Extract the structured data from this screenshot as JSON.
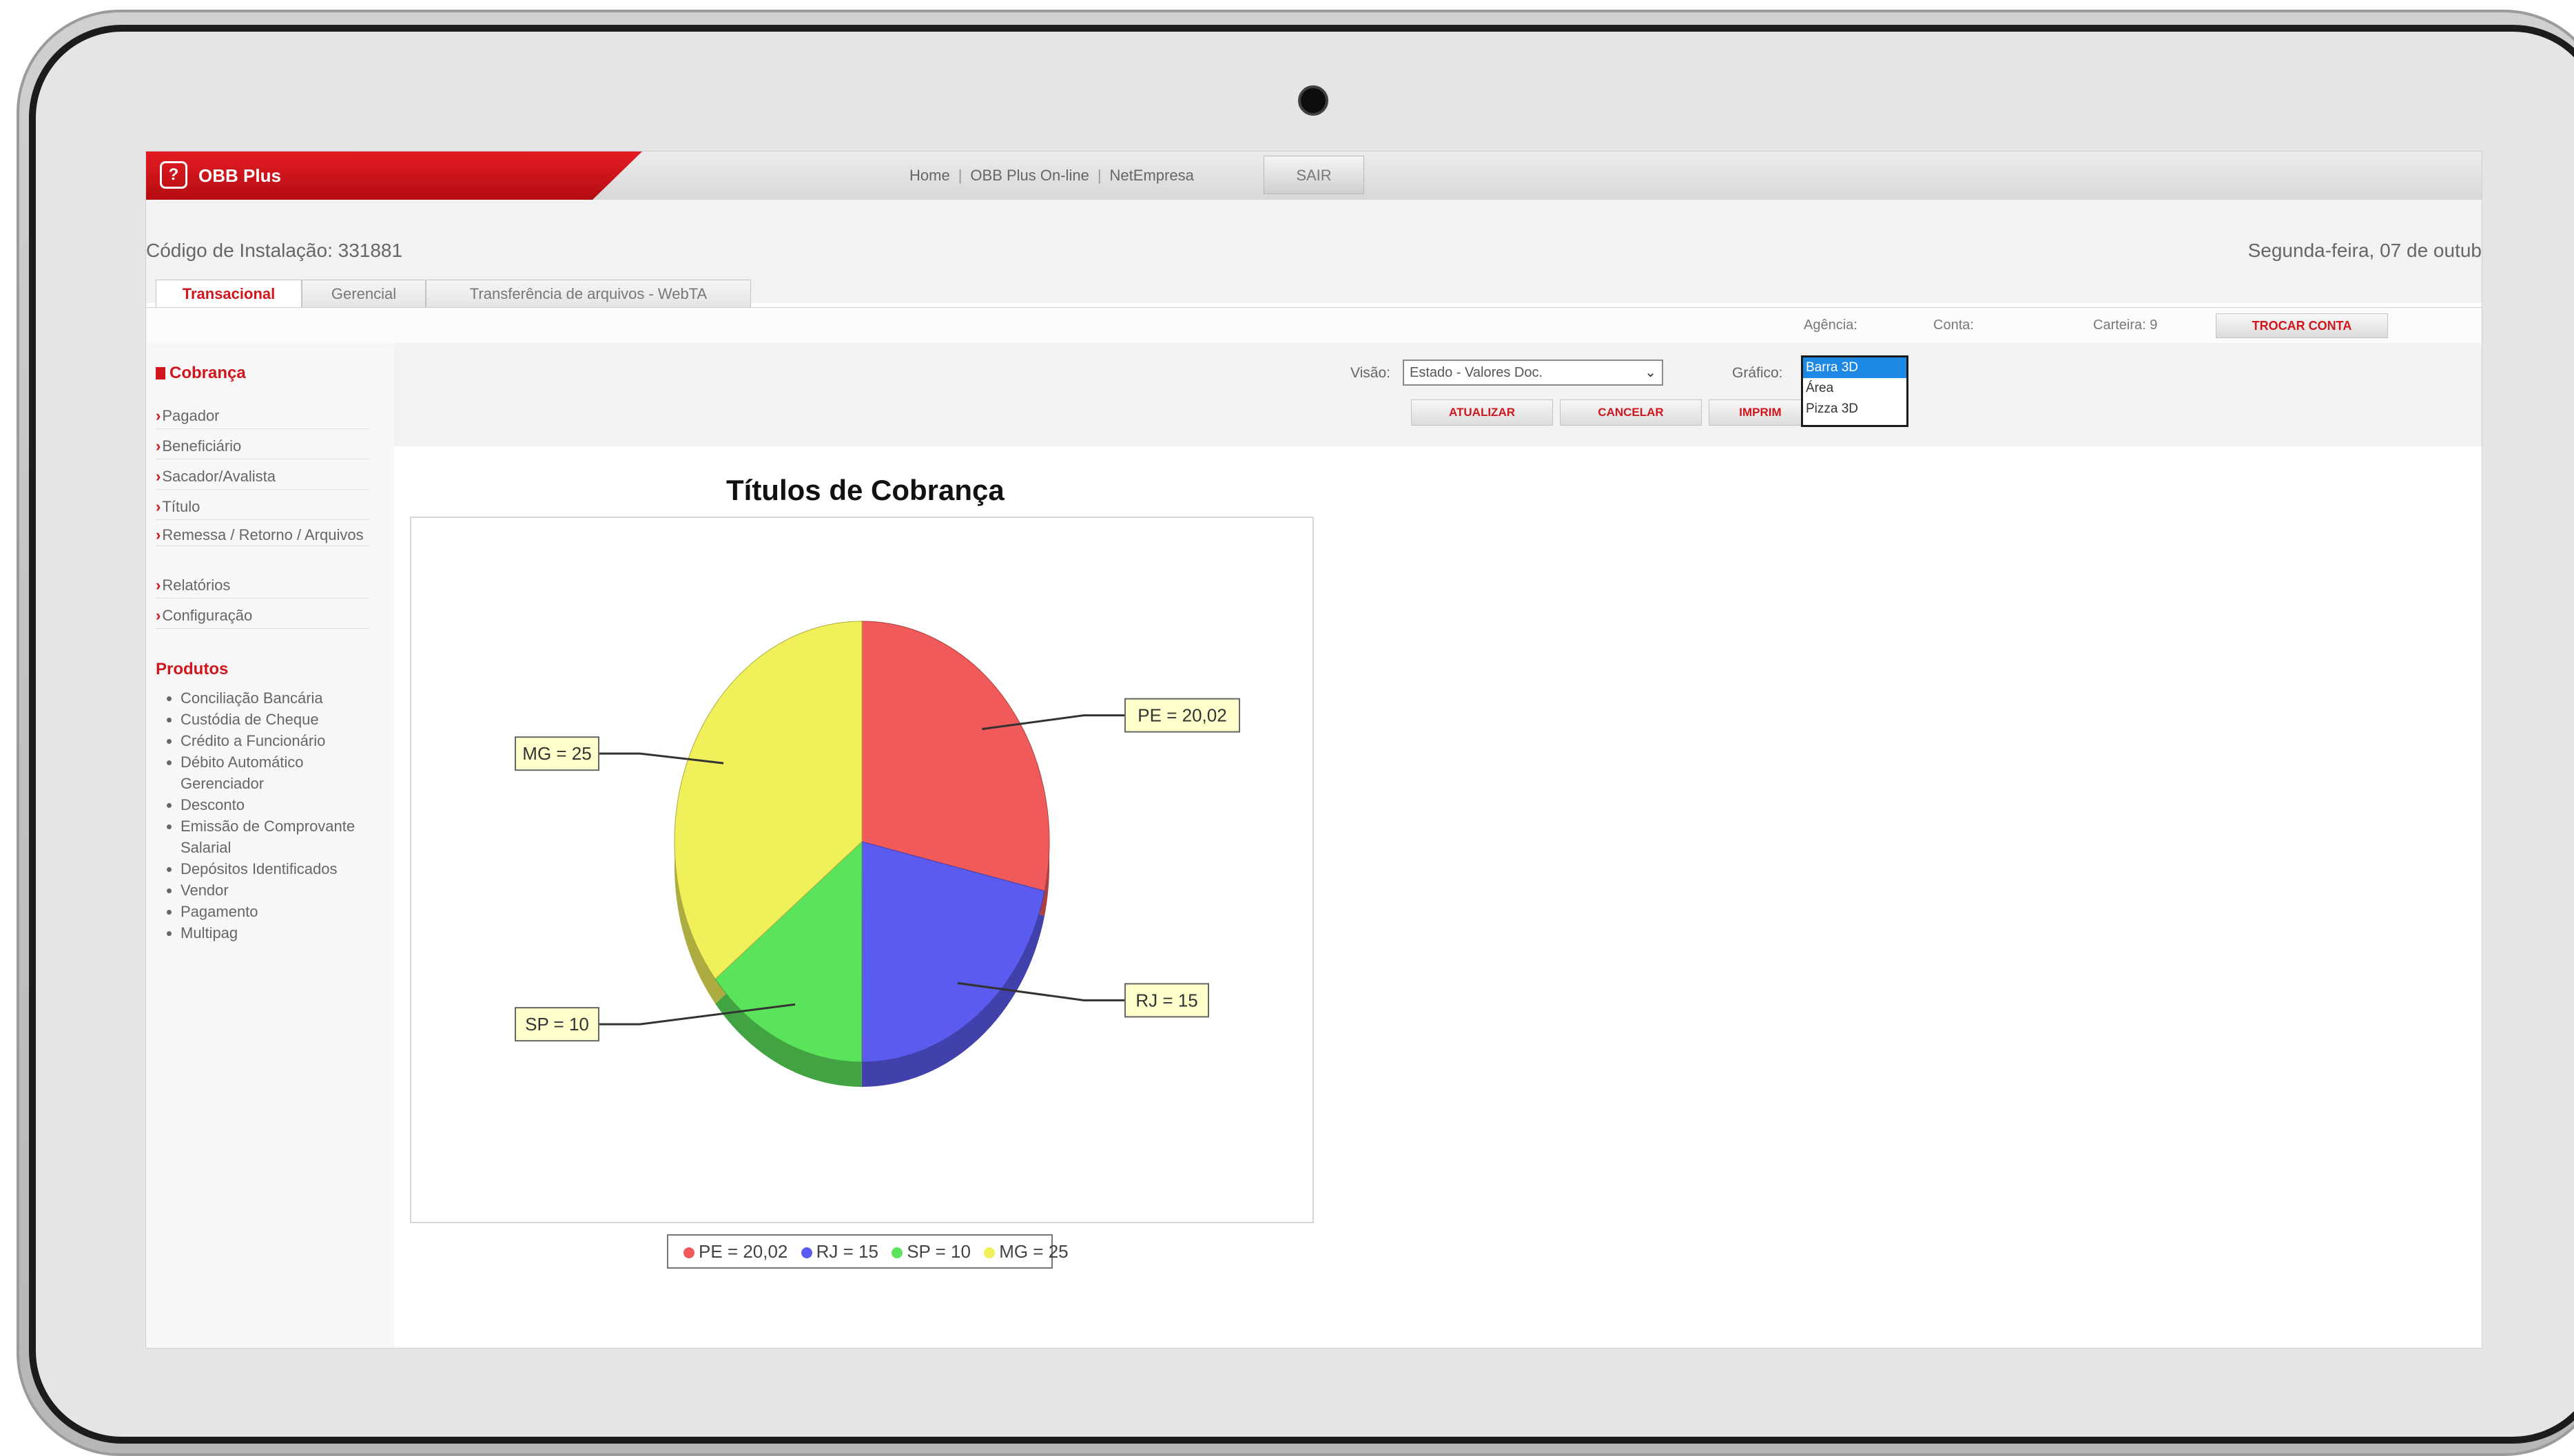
{
  "brand": {
    "logo": "?",
    "name": "OBB Plus"
  },
  "topnav": {
    "home": "Home",
    "online": "OBB Plus On-line",
    "netempresa": "NetEmpresa",
    "sep": "|",
    "sair": "SAIR"
  },
  "header": {
    "install": "Código de Instalação: 331881",
    "date": "Segunda-feira, 07 de outub"
  },
  "tabs": [
    "Transacional",
    "Gerencial",
    "Transferência de arquivos - WebTA"
  ],
  "account": {
    "agencia": "Agência:",
    "conta": "Conta:",
    "carteira": "Carteira: 9",
    "trocar": "TROCAR CONTA"
  },
  "controls": {
    "visao_label": "Visão:",
    "visao_value": "Estado - Valores Doc.",
    "grafico_label": "Gráfico:",
    "dropdown_options": [
      "Barra 3D",
      "Área",
      "Pizza 3D"
    ],
    "dropdown_selected": "Barra 3D",
    "atualizar": "ATUALIZAR",
    "cancelar": "CANCELAR",
    "imprimir": "IMPRIM"
  },
  "sidebar": {
    "title": "Cobrança",
    "items": [
      "Pagador",
      "Beneficiário",
      "Sacador/Avalista",
      "Título",
      "Remessa / Retorno / Arquivos",
      "Relatórios",
      "Configuração"
    ],
    "products_title": "Produtos",
    "products": [
      "Conciliação Bancária",
      "Custódia de Cheque",
      "Crédito a Funcionário",
      "Débito Automático Gerenciador",
      "Desconto",
      "Emissão de Comprovante Salarial",
      "Depósitos Identificados",
      "Vendor",
      "Pagamento",
      "Multipag"
    ]
  },
  "icons": {
    "logo": "bank-logo-icon",
    "bullet": "red-square-icon",
    "arrow": "red-arrow-icon",
    "caret": "chevron-down-icon"
  },
  "colors": {
    "brand_red": "#d0161c",
    "pe": "#f05a5a",
    "rj": "#5b5bef",
    "sp": "#5ce35c",
    "mg": "#f0f05a",
    "dropdown_selected": "#1e88e5"
  },
  "chart_data": {
    "type": "pie",
    "title": "Títulos de Cobrança",
    "style": "3d",
    "categories": [
      "PE",
      "RJ",
      "SP",
      "MG"
    ],
    "values": [
      20.02,
      15,
      10,
      25
    ],
    "labels": [
      "PE = 20,02",
      "RJ = 15",
      "SP = 10",
      "MG = 25"
    ],
    "legend": [
      "PE = 20,02",
      "RJ = 15",
      "SP = 10",
      "MG = 25"
    ],
    "legend_position": "bottom"
  }
}
